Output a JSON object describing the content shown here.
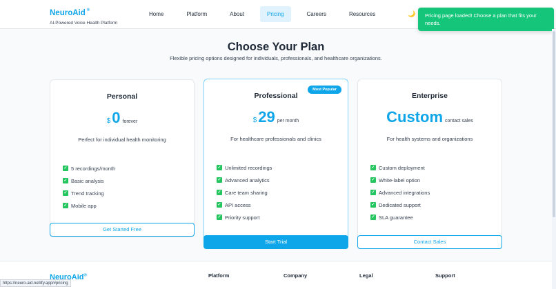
{
  "brand": {
    "name": "NeuroAid",
    "reg": "®",
    "tagline": "AI-Powered Voice Health Platform"
  },
  "nav": {
    "items": [
      {
        "label": "Home"
      },
      {
        "label": "Platform"
      },
      {
        "label": "About"
      },
      {
        "label": "Pricing",
        "active": true
      },
      {
        "label": "Careers"
      },
      {
        "label": "Resources"
      }
    ],
    "theme_icon": "🌙"
  },
  "toast": {
    "message": "Pricing page loaded! Choose a plan that fits your needs."
  },
  "hero": {
    "title": "Choose Your Plan",
    "subtitle": "Flexible pricing options designed for individuals, professionals, and healthcare organizations."
  },
  "plans": [
    {
      "name": "Personal",
      "currency": "$",
      "amount": "0",
      "period": "forever",
      "description": "Perfect for individual health monitoring",
      "features": [
        "5 recordings/month",
        "Basic analysis",
        "Trend tracking",
        "Mobile app"
      ],
      "cta": "Get Started Free"
    },
    {
      "name": "Professional",
      "badge": "Most Popular",
      "currency": "$",
      "amount": "29",
      "period": "per month",
      "description": "For healthcare professionals and clinics",
      "features": [
        "Unlimited recordings",
        "Advanced analytics",
        "Care team sharing",
        "API access",
        "Priority support"
      ],
      "cta": "Start Trial"
    },
    {
      "name": "Enterprise",
      "currency": "",
      "amount": "Custom",
      "period": "contact sales",
      "description": "For health systems and organizations",
      "features": [
        "Custom deployment",
        "White-label option",
        "Advanced integrations",
        "Dedicated support",
        "SLA guarantee"
      ],
      "cta": "Contact Sales"
    }
  ],
  "footer": {
    "brand": "NeuroAid",
    "reg": "®",
    "columns": [
      "Platform",
      "Company",
      "Legal",
      "Support"
    ]
  },
  "status": {
    "url": "https://neuro-aid.netlify.app/#pricing"
  },
  "colors": {
    "accent": "#0ea5e9",
    "success": "#15c57a",
    "check": "#22c55e"
  }
}
